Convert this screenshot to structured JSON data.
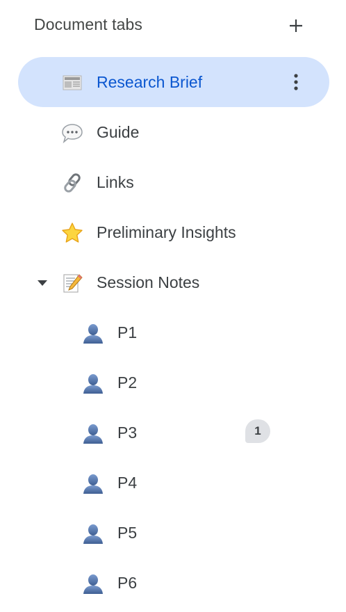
{
  "header": {
    "title": "Document tabs",
    "add_icon": "plus-icon"
  },
  "tabs": [
    {
      "label": "Research Brief",
      "icon": "newspaper-emoji-icon",
      "selected": true
    },
    {
      "label": "Guide",
      "icon": "speech-bubble-emoji-icon"
    },
    {
      "label": "Links",
      "icon": "link-emoji-icon"
    },
    {
      "label": "Preliminary Insights",
      "icon": "star-emoji-icon"
    },
    {
      "label": "Session Notes",
      "icon": "memo-emoji-icon",
      "expanded": true
    }
  ],
  "session_notes_children": [
    {
      "label": "P1",
      "icon": "bust-silhouette-emoji-icon"
    },
    {
      "label": "P2",
      "icon": "bust-silhouette-emoji-icon"
    },
    {
      "label": "P3",
      "icon": "bust-silhouette-emoji-icon",
      "comment_count": "1"
    },
    {
      "label": "P4",
      "icon": "bust-silhouette-emoji-icon"
    },
    {
      "label": "P5",
      "icon": "bust-silhouette-emoji-icon"
    },
    {
      "label": "P6",
      "icon": "bust-silhouette-emoji-icon"
    }
  ],
  "colors": {
    "selected_background": "#d3e3fd",
    "selected_text": "#0b57d0",
    "text": "#3c4043",
    "badge_background": "#dfe1e5"
  }
}
